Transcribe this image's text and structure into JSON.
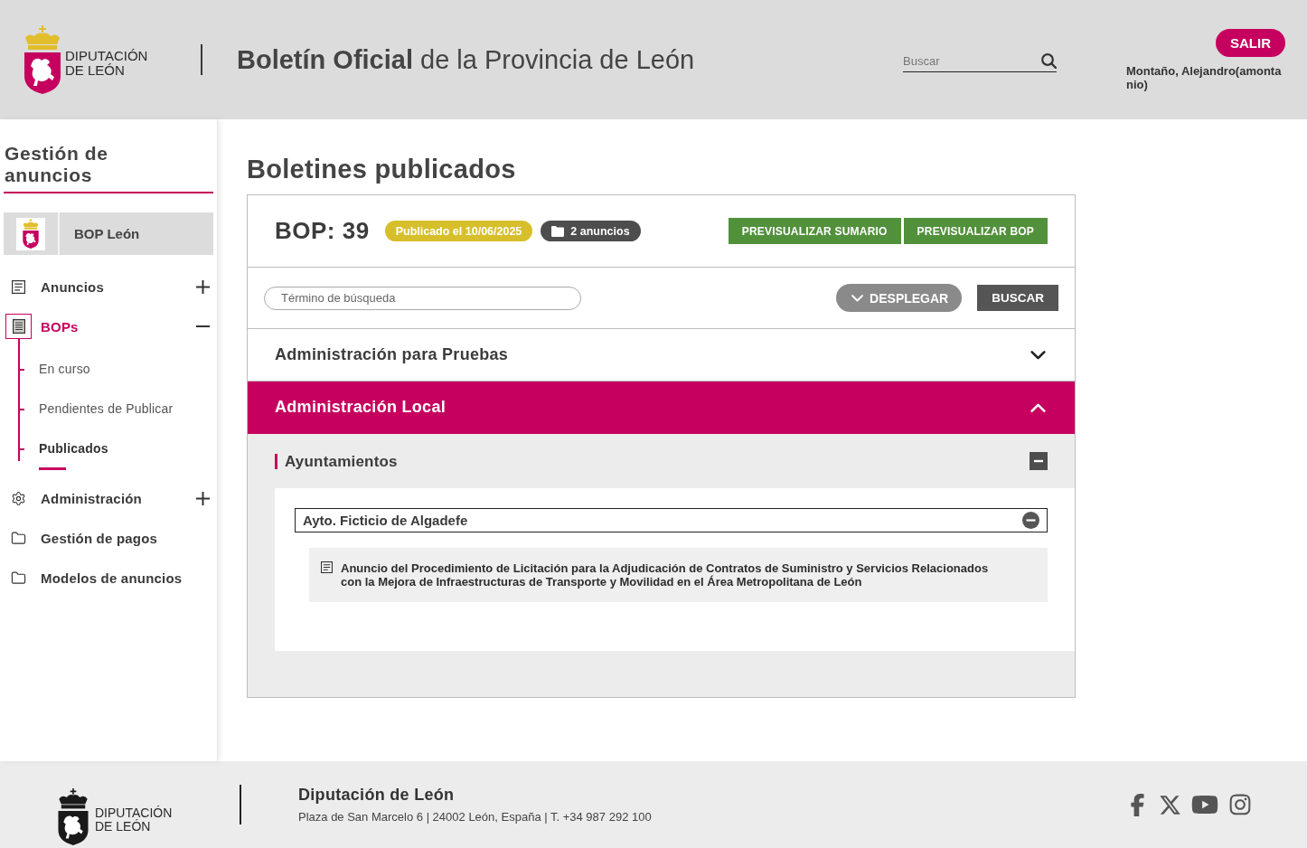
{
  "header": {
    "logo_text": "DIPUTACIÓN DE LEÓN",
    "title": "**Boletín Oficial** de la Provincia de León",
    "search": {
      "placeholder": "Buscar"
    },
    "logout_button": "SALIR",
    "user_name": "Montaño, Alejandro(amontanio)"
  },
  "sidebar": {
    "title": "Gestión de anuncios",
    "site_name": "BOP León",
    "items": [
      {
        "label": "Anuncios",
        "kind": "group",
        "selected": false,
        "expanded": false
      },
      {
        "label": "BOPs",
        "kind": "group",
        "selected": true,
        "expanded": true,
        "children": [
          {
            "label": "En curso",
            "selected": false
          },
          {
            "label": "Pendientes de Publicar",
            "selected": false
          },
          {
            "label": "Publicados",
            "selected": true
          }
        ]
      },
      {
        "label": "Administración",
        "kind": "group",
        "selected": false,
        "expanded": false
      },
      {
        "label": "Gestión de pagos",
        "kind": "link",
        "selected": false
      },
      {
        "label": "Modelos de anuncios",
        "kind": "link",
        "selected": false
      }
    ]
  },
  "main": {
    "title": "Boletines publicados",
    "bulletin": {
      "number": "BOP: 39",
      "status_badge": "Publicado el 10/06/2025",
      "count_badge": "2 anuncios",
      "actions": [
        "PREVISUALIZAR SUMARIO",
        "PREVISUALIZAR BOP"
      ]
    },
    "filter": {
      "search": {
        "placeholder": "Término de búsqueda"
      },
      "expand_button": "DESPLEGAR",
      "search_button": "BUSCAR"
    },
    "sections": [
      {
        "title": "Administración para Pruebas",
        "expanded": false
      },
      {
        "title": "Administración Local",
        "expanded": true,
        "groups": [
          {
            "title": "Ayuntamientos",
            "expanded": true,
            "entities": [
              {
                "name": "Ayto. Ficticio de Algadefe",
                "expanded": true,
                "announcements": [
                  "Anuncio del Procedimiento de Licitación para la Adjudicación de Contratos de Suministro y Servicios Relacionados con la Mejora de Infraestructuras de Transporte y Movilidad en el Área Metropolitana de León"
                ]
              }
            ]
          }
        ]
      }
    ]
  },
  "footer": {
    "logo_text": "DIPUTACIÓN DE LEÓN",
    "org_name": "Diputación de León",
    "address": "Plaza de San Marcelo 6 | 24002 León, España | T. +34 987 292 100"
  }
}
